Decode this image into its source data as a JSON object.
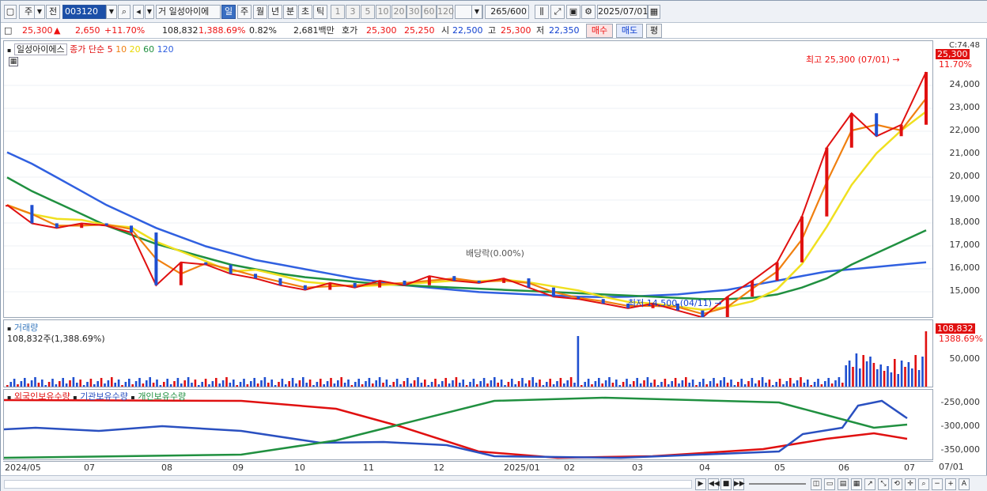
{
  "toolbar": {
    "market": "주",
    "prev_label": "전",
    "code": "003120",
    "trade_label": "거",
    "stock_name": "일성아이에",
    "periods": [
      "일",
      "주",
      "월",
      "년",
      "분",
      "초",
      "틱"
    ],
    "selected_period": "일",
    "intervals": [
      "1",
      "3",
      "5",
      "10",
      "20",
      "30",
      "60",
      "120"
    ],
    "count": "265",
    "count_max": "/600",
    "date": "2025/07/01"
  },
  "quote": {
    "price": "25,300",
    "arrow": "▲",
    "change": "2,650",
    "change_pct": "+11.70%",
    "volume": "108,832",
    "volume_ratio": "1,388.69%",
    "turnover": "0.82%",
    "amount": "2,681백만",
    "ask_label": "호가",
    "ask": "25,300",
    "bid": "25,250",
    "open_label": "시",
    "open": "22,500",
    "high_label": "고",
    "high": "25,300",
    "low_label": "저",
    "low": "22,350",
    "buy_label": "매수",
    "sell_label": "매도",
    "eval_label": "평"
  },
  "price_pane": {
    "stock_label": "일성아이에스",
    "ma_title": "종가 단순",
    "ma_periods": [
      "5",
      "10",
      "20",
      "60",
      "120"
    ],
    "ma_colors": [
      "#e01010",
      "#f08010",
      "#f0e020",
      "#209040",
      "#3060e0"
    ],
    "top_label": "C:74.48",
    "current_label": "25,300",
    "current_pct": "11.70%",
    "high_anno": "최고 25,300 (07/01)",
    "low_anno": "최저 14,500 (04/11)",
    "dividend_anno": "배당락(0.00%)",
    "y_ticks": [
      "24,000",
      "23,000",
      "22,000",
      "21,000",
      "20,000",
      "19,000",
      "18,000",
      "17,000",
      "16,000",
      "15,000"
    ]
  },
  "volume_pane": {
    "title": "거래량",
    "value_label": "108,832주(1,388.69%)",
    "current_label": "108,832",
    "current_pct": "1388.69%",
    "y_ticks": [
      "50,000"
    ]
  },
  "holdings_pane": {
    "legend": [
      "외국인보유수량",
      "기관보유수량",
      "개인보유수량"
    ],
    "y_ticks": [
      "-250,000",
      "-300,000",
      "-350,000"
    ]
  },
  "x_axis": {
    "labels": [
      "2024/05",
      "07",
      "08",
      "09",
      "10",
      "11",
      "12",
      "2025/01",
      "02",
      "03",
      "04",
      "05",
      "06",
      "07"
    ],
    "right_label": "07/01"
  },
  "chart_data": {
    "type": "line",
    "price_range": [
      14500,
      25300
    ],
    "close": [
      19500,
      18700,
      18500,
      18700,
      18600,
      18300,
      16000,
      17000,
      16900,
      16500,
      16300,
      16000,
      15800,
      16100,
      15900,
      16200,
      16000,
      16400,
      16200,
      16100,
      16300,
      15900,
      15500,
      15400,
      15200,
      15000,
      15200,
      14900,
      14600,
      15500,
      16200,
      17000,
      19000,
      22000,
      23500,
      22500,
      23000,
      25300
    ],
    "ma120": [
      21800,
      21300,
      20700,
      20100,
      19500,
      19000,
      18500,
      18100,
      17700,
      17400,
      17100,
      16900,
      16700,
      16500,
      16300,
      16150,
      16000,
      15900,
      15800,
      15700,
      15650,
      15600,
      15550,
      15500,
      15480,
      15500,
      15550,
      15600,
      15700,
      15800,
      16000,
      16200,
      16400,
      16600,
      16700,
      16800,
      16900,
      17000
    ],
    "ma60": [
      20700,
      20100,
      19600,
      19100,
      18600,
      18200,
      17800,
      17500,
      17200,
      16900,
      16700,
      16500,
      16350,
      16250,
      16150,
      16050,
      16000,
      15950,
      15900,
      15850,
      15800,
      15750,
      15700,
      15650,
      15600,
      15550,
      15500,
      15450,
      15400,
      15400,
      15450,
      15600,
      15900,
      16300,
      16900,
      17400,
      17900,
      18400
    ]
  }
}
